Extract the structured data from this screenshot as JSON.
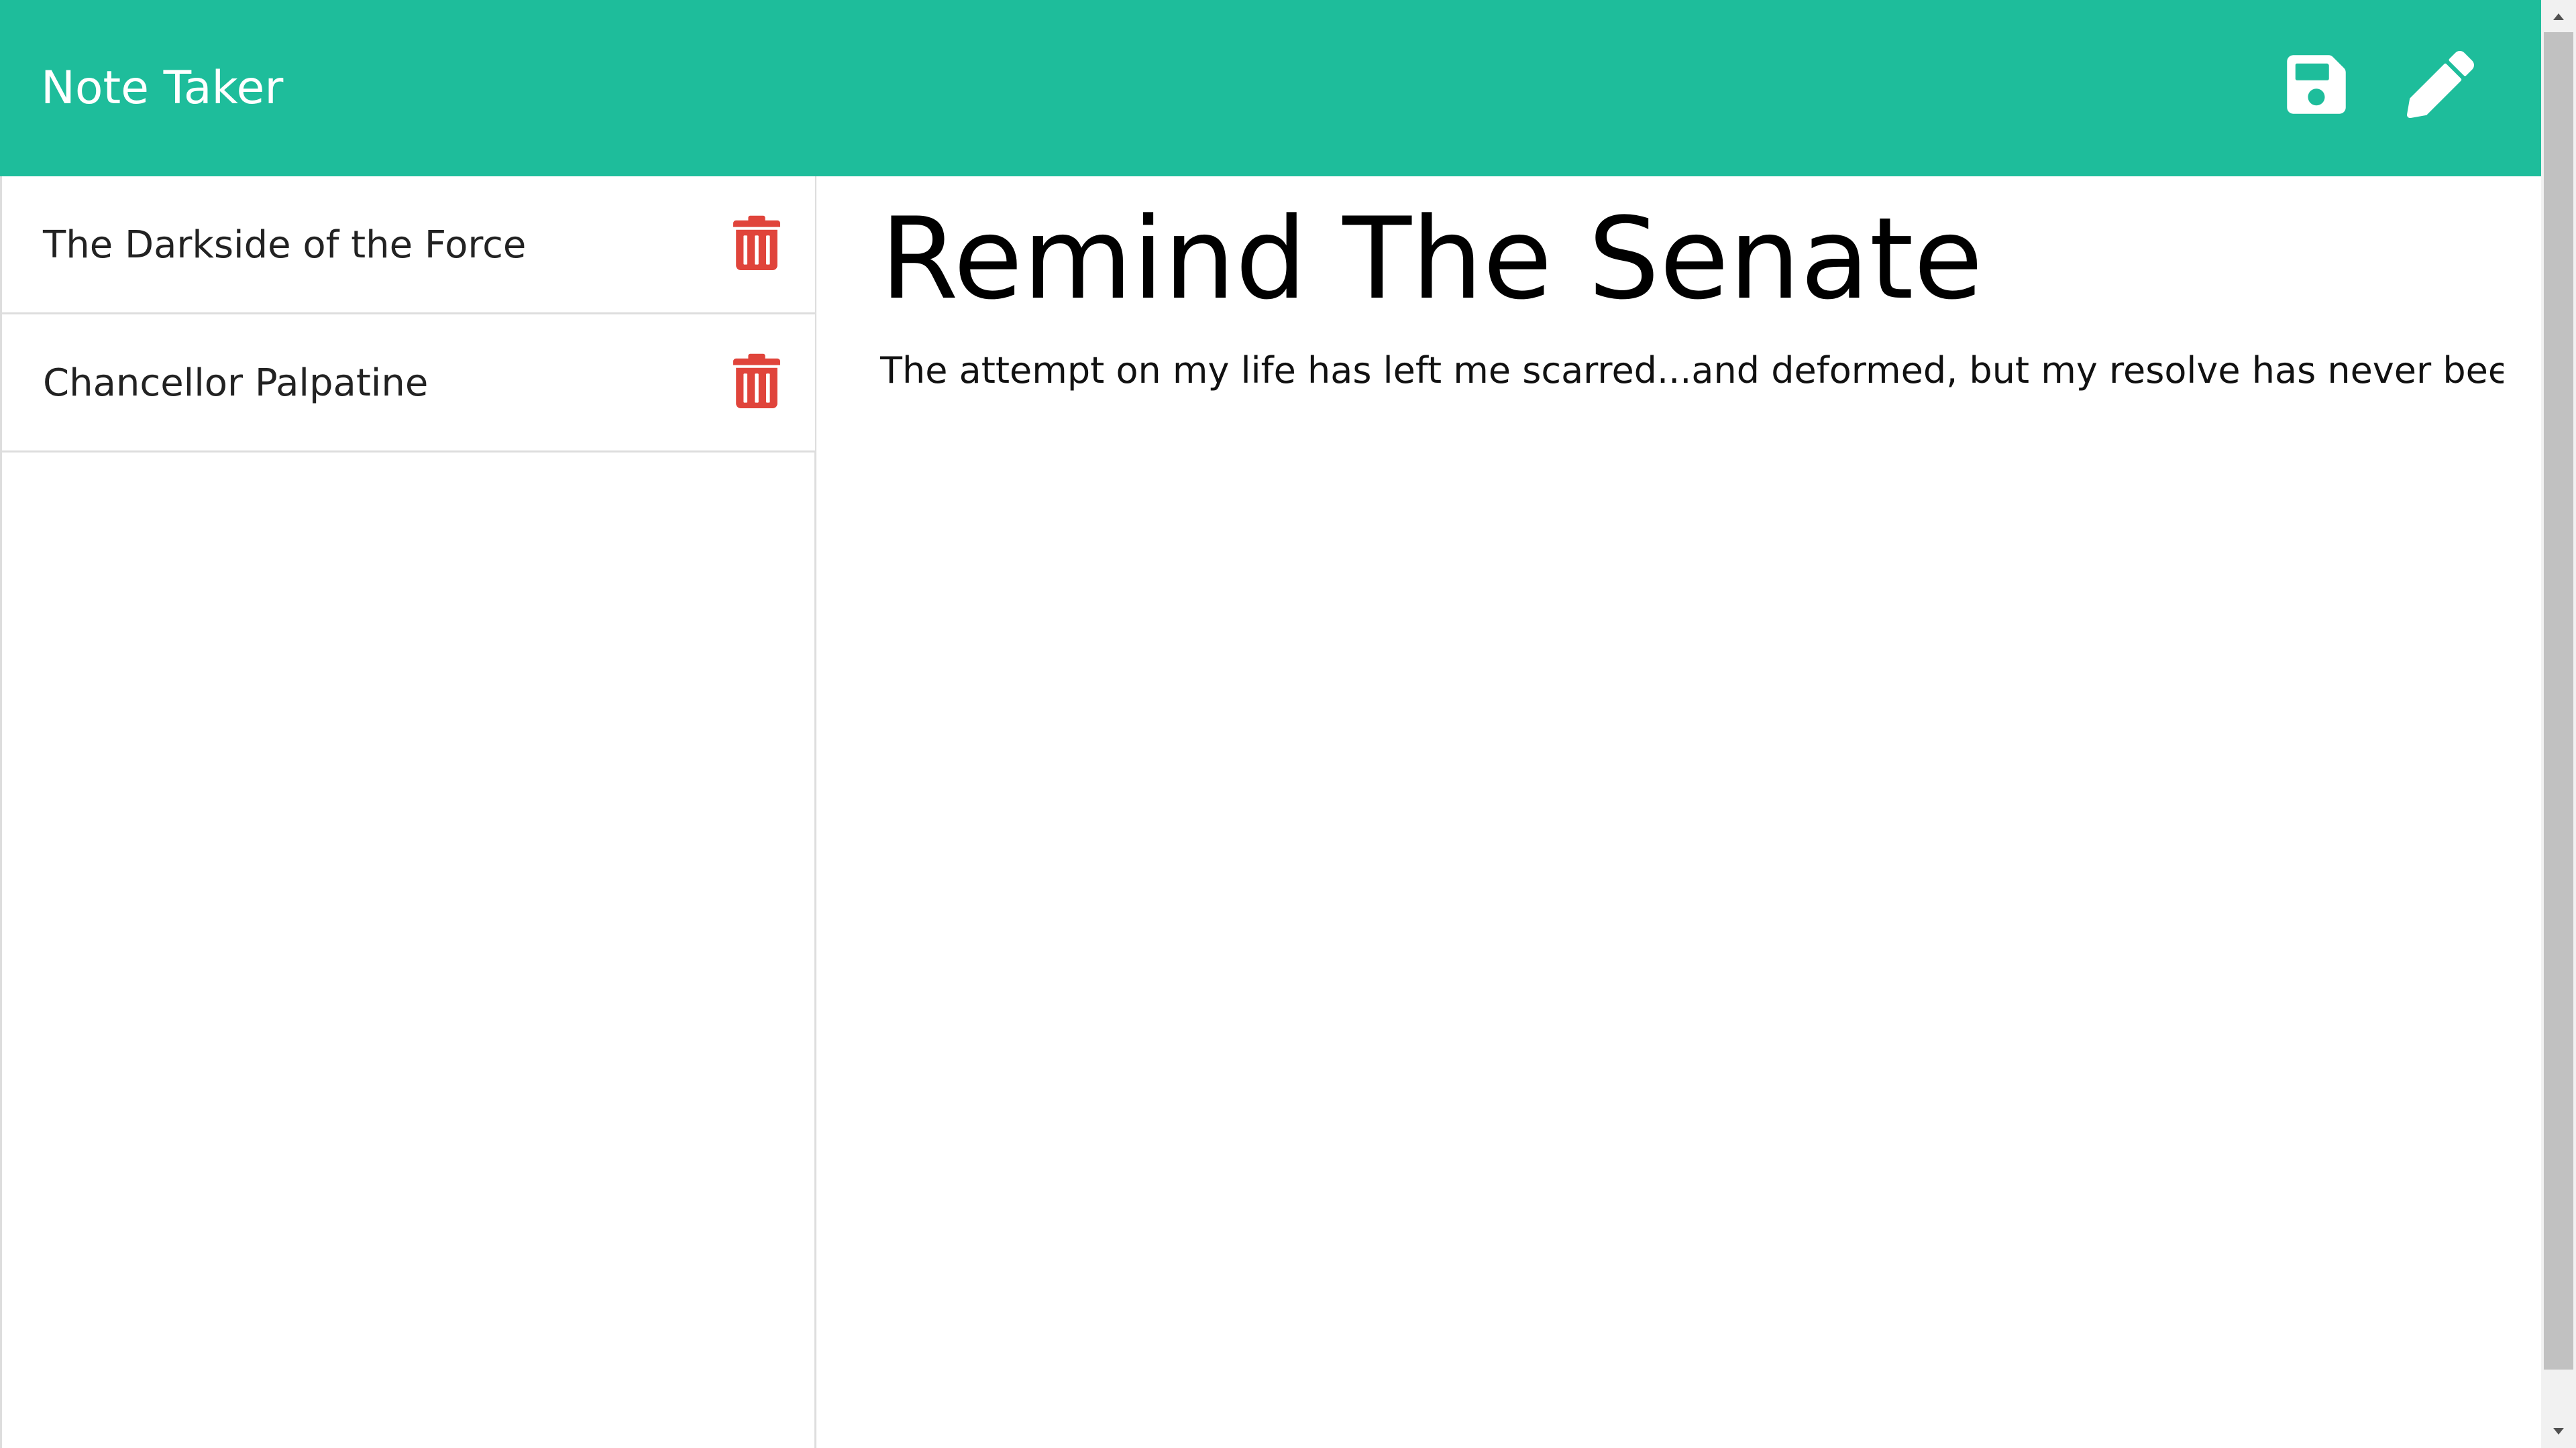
{
  "header": {
    "title": "Note Taker",
    "save_icon": "save-icon",
    "new_note_icon": "pencil-icon",
    "background_color": "#1ebd9b"
  },
  "sidebar": {
    "notes": [
      {
        "title": "The Darkside of the Force",
        "delete_icon": "trash-icon"
      },
      {
        "title": "Chancellor Palpatine",
        "delete_icon": "trash-icon"
      }
    ],
    "delete_icon_color": "#e0443b"
  },
  "editor": {
    "title": "Remind The Senate",
    "text": "The attempt on my life has left me scarred...and deformed, but my resolve has never been"
  }
}
